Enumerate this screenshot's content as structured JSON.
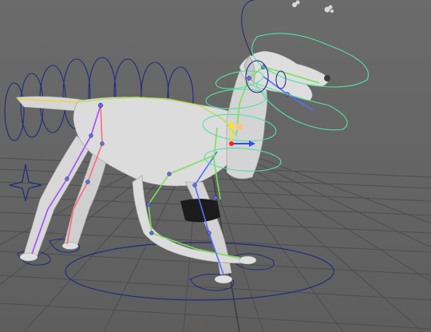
{
  "viewport": {
    "background": "#6a6a6a",
    "grid_color": "#4a4a4a",
    "grid_axis_color": "#333333"
  },
  "rig": {
    "mesh_color": "#dadada",
    "mesh_shadow": "#a9a9a9",
    "ik_curve_color": "#1f2b80",
    "fk_curve_color": "#54e0a6",
    "joint_colors": [
      "#ff6a7a",
      "#a24dff",
      "#5b6cff",
      "#7be05b",
      "#f5d14a"
    ]
  },
  "labels": {
    "head_control": "",
    "head_control_top": ""
  },
  "gizmo": {
    "x_axis_color": "#2f4bff",
    "y_axis_color": "#ffe21a",
    "center_color": "#ff2020"
  },
  "icons": {
    "move_gizmo": "move-manipulator-icon",
    "tail_rig": "tail-spiral-control-icon"
  }
}
